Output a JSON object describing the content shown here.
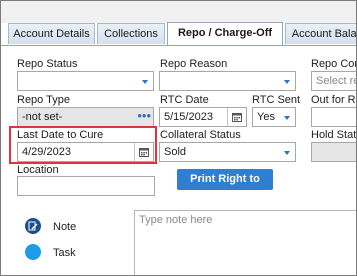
{
  "tabs": [
    {
      "label": "Account Details"
    },
    {
      "label": "Collections"
    },
    {
      "label": "Repo / Charge-Off",
      "active": true
    },
    {
      "label": "Account Balanc"
    }
  ],
  "form": {
    "repo_status": {
      "label": "Repo Status",
      "value": ""
    },
    "repo_reason": {
      "label": "Repo Reason",
      "value": ""
    },
    "repo_com": {
      "label": "Repo Com",
      "placeholder": "Select rep"
    },
    "repo_type": {
      "label": "Repo Type",
      "value": "-not set-"
    },
    "rtc_date": {
      "label": "RTC Date",
      "value": "5/15/2023"
    },
    "rtc_sent": {
      "label": "RTC Sent",
      "value": "Yes"
    },
    "out_for_re": {
      "label": "Out for Re"
    },
    "last_date_to_cure": {
      "label": "Last Date to Cure",
      "value": "4/29/2023"
    },
    "collateral_status": {
      "label": "Collateral Status",
      "value": "Sold"
    },
    "hold_status": {
      "label": "Hold Statu"
    },
    "location": {
      "label": "Location",
      "value": ""
    }
  },
  "print_button": {
    "label": "Print Right to Cure"
  },
  "activity": {
    "note_label": "Note",
    "task_label": "Task",
    "note_placeholder": "Type note here"
  },
  "colors": {
    "accent": "#2e7ed2",
    "highlight": "#d9363e"
  }
}
